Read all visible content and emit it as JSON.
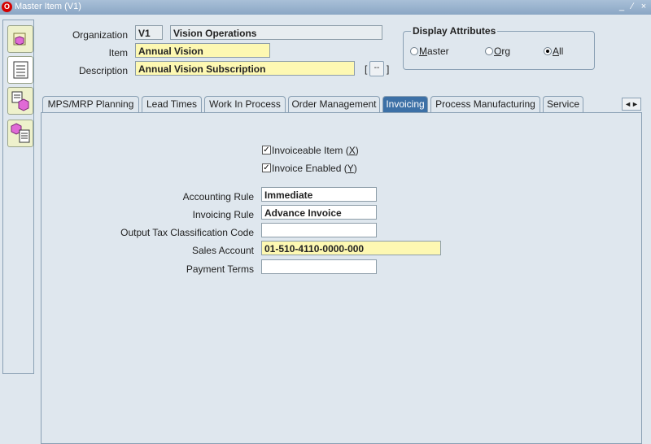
{
  "window": {
    "title": "Master Item (V1)",
    "logo": "O",
    "controls": [
      "_",
      "∕",
      "×"
    ]
  },
  "header": {
    "organization_label": "Organization",
    "organization_code": "V1",
    "organization_name": "Vision Operations",
    "item_label": "Item",
    "item_value": "Annual Vision",
    "description_label": "Description",
    "description_value": "Annual Vision Subscription",
    "dots_label": "--",
    "bracket_left": "[",
    "bracket_right": "]"
  },
  "display_attributes": {
    "title": "Display Attributes",
    "options": [
      {
        "label": "Master",
        "underline": "M",
        "selected": false
      },
      {
        "label": "Org",
        "underline": "O",
        "selected": false
      },
      {
        "label": "All",
        "underline": "A",
        "selected": true
      }
    ]
  },
  "tabs": [
    {
      "label": "MPS/MRP Planning",
      "active": false
    },
    {
      "label": "Lead Times",
      "active": false
    },
    {
      "label": "Work In Process",
      "active": false
    },
    {
      "label": "Order Management",
      "active": false
    },
    {
      "label": "Invoicing",
      "active": true
    },
    {
      "label": "Process Manufacturing",
      "active": false
    },
    {
      "label": "Service",
      "active": false
    }
  ],
  "tab_scroll_label": "◄►",
  "invoicing": {
    "invoiceable_item": {
      "label": "Invoiceable Item",
      "mnemonic": "X",
      "checked": true
    },
    "invoice_enabled": {
      "label": "Invoice Enabled",
      "mnemonic": "Y",
      "checked": true
    },
    "check_mark": "✓",
    "accounting_rule": {
      "label": "Accounting Rule",
      "value": "Immediate"
    },
    "invoicing_rule": {
      "label": "Invoicing Rule",
      "value": "Advance Invoice"
    },
    "output_tax": {
      "label": "Output Tax Classification Code",
      "value": ""
    },
    "sales_account": {
      "label": "Sales Account",
      "value": "01-510-4110-0000-000"
    },
    "payment_terms": {
      "label": "Payment Terms",
      "value": ""
    }
  },
  "side_toolbar": [
    "item-cube-icon",
    "list-icon",
    "item-list-icon",
    "item-detail-icon"
  ]
}
